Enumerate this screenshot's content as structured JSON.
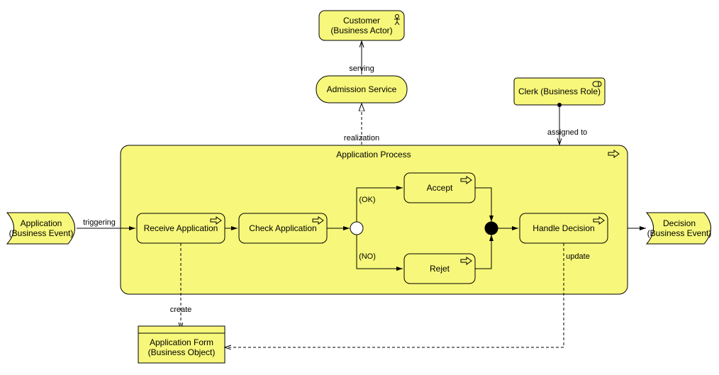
{
  "customer": {
    "line1": "Customer",
    "line2": "(Business Actor)"
  },
  "admission_service": {
    "label": "Admission Service"
  },
  "clerk": {
    "label": "Clerk (Business Role)"
  },
  "process": {
    "title": "Application Process"
  },
  "event_in": {
    "line1": "Application",
    "line2": "(Business Event)"
  },
  "event_out": {
    "line1": "Decision",
    "line2": "(Business Event)"
  },
  "receive": {
    "label": "Receive Application"
  },
  "check": {
    "label": "Check Application"
  },
  "accept": {
    "label": "Accept"
  },
  "reject": {
    "label": "Rejet"
  },
  "handle": {
    "label": "Handle Decision"
  },
  "object": {
    "line1": "Application Form",
    "line2": "(Business Object)"
  },
  "rel": {
    "serving": "serving",
    "realization": "realization",
    "assigned_to": "assigned to",
    "triggering": "triggering",
    "ok": "(OK)",
    "no": "(NO)",
    "create": "create",
    "update": "update"
  }
}
